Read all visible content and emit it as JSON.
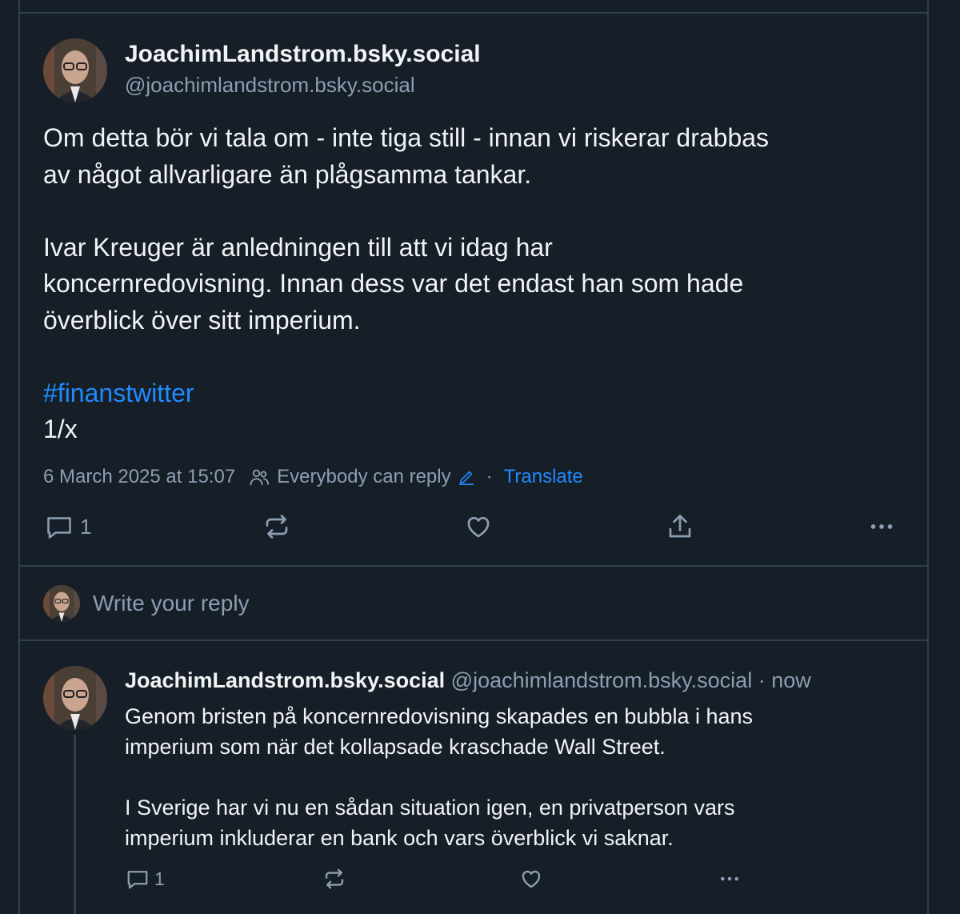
{
  "main_post": {
    "display_name": "JoachimLandstrom.bsky.social",
    "handle": "@joachimlandstrom.bsky.social",
    "text_p1_l1": "Om detta bör vi tala om - inte tiga still - innan vi riskerar drabbas",
    "text_p1_l2": "av något allvarligare än plågsamma tankar.",
    "text_p2_l1": "Ivar Kreuger är anledningen till att vi idag har",
    "text_p2_l2": "koncernredovisning. Innan dess var det endast han som hade",
    "text_p2_l3": "överblick över sitt imperium.",
    "hashtag": "#finanstwitter",
    "thread_marker": "1/x",
    "timestamp": "6 March 2025 at 15:07",
    "reply_setting": "Everybody can reply",
    "separator": "·",
    "translate": "Translate",
    "reply_count": "1"
  },
  "composer": {
    "placeholder": "Write your reply"
  },
  "reply_post": {
    "display_name": "JoachimLandstrom.bsky.social",
    "handle": "@joachimlandstrom.bsky.social",
    "time": "· now",
    "text_p1_l1": "Genom bristen på koncernredovisning skapades en bubbla i hans",
    "text_p1_l2": "imperium som när det kollapsade kraschade Wall Street.",
    "text_p2_l1": "I Sverige har vi nu en sådan situation igen, en privatperson vars",
    "text_p2_l2": "imperium inkluderar en bank och vars överblick vi saknar.",
    "reply_count": "1"
  },
  "icons": {
    "reply": "reply-icon",
    "repost": "repost-icon",
    "like": "heart-icon",
    "share": "share-icon",
    "more": "more-icon",
    "people": "people-icon",
    "edit": "pencil-icon"
  },
  "colors": {
    "background": "#161e27",
    "border": "#2e4052",
    "text": "#f1f3f5",
    "muted": "#8c9eb2",
    "accent": "#208bfe"
  }
}
